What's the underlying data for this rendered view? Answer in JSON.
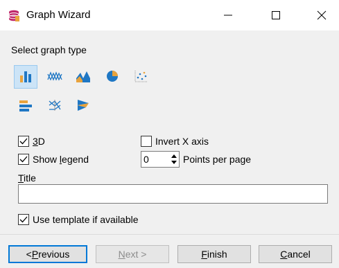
{
  "window": {
    "title": "Graph Wizard"
  },
  "section": {
    "select_label": "Select graph type"
  },
  "graph_types": [
    {
      "name": "bar",
      "selected": true
    },
    {
      "name": "line",
      "selected": false
    },
    {
      "name": "area",
      "selected": false
    },
    {
      "name": "pie",
      "selected": false
    },
    {
      "name": "scatter",
      "selected": false
    },
    {
      "name": "horizontal-bar",
      "selected": false
    },
    {
      "name": "parallel",
      "selected": false
    },
    {
      "name": "funnel",
      "selected": false
    }
  ],
  "options": {
    "three_d": {
      "label_underlined": "3",
      "label_rest": "D",
      "checked": true
    },
    "show_legend": {
      "label_before": "Show ",
      "label_underlined": "l",
      "label_after": "egend",
      "checked": true
    },
    "invert_x": {
      "label": "Invert X axis",
      "checked": false
    },
    "points_per_page": {
      "value": "0",
      "label": "Points per page"
    },
    "use_template": {
      "label": "Use template if available",
      "checked": true
    }
  },
  "title_field": {
    "label_underlined": "T",
    "label_rest": "itle",
    "value": ""
  },
  "buttons": {
    "previous": {
      "prefix": "< ",
      "underlined": "P",
      "rest": "revious"
    },
    "next": {
      "underlined": "N",
      "rest": "ext >"
    },
    "finish": {
      "underlined": "F",
      "rest": "inish"
    },
    "cancel": {
      "underlined": "C",
      "rest": "ancel"
    }
  },
  "colors": {
    "accent": "#0078d7",
    "icon_blue": "#1f77c4",
    "icon_orange": "#e8a33d",
    "app_icon": "#c0286b"
  }
}
